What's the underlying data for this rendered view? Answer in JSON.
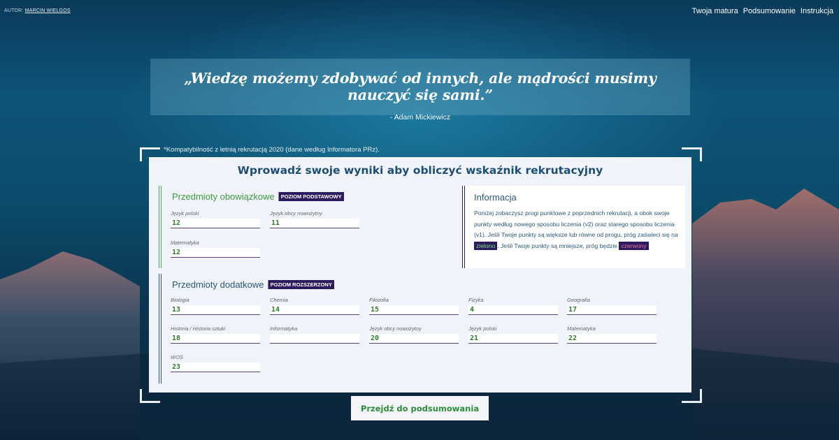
{
  "header": {
    "author_prefix": "AUTOR:",
    "author_name": "MARCIN WIELGOS",
    "nav": [
      "Twoja matura",
      "Podsumowanie",
      "Instrukcja"
    ]
  },
  "quote": {
    "text": "„Wiedzę możemy zdobywać od innych, ale mądrości musimy nauczyć się sami.”",
    "author": "- Adam Mickiewicz"
  },
  "compat_note": "*Kompatybilność z letnią rekrutacją 2020 (dane według Informatora PRz).",
  "form": {
    "title": "Wprowadź swoje wyniki aby obliczyć wskaźnik rekrutacyjny",
    "mandatory": {
      "title": "Przedmioty obowiązkowe",
      "level": "POZIOM PODSTAWOWY",
      "fields": [
        {
          "label": "Język polski",
          "value": "12"
        },
        {
          "label": "Język obcy nowożytny",
          "value": "11"
        },
        {
          "label": "Matematyka",
          "value": "12"
        }
      ]
    },
    "extra": {
      "title": "Przedmioty dodatkowe",
      "level": "POZIOM ROZSZERZONY",
      "fields": [
        {
          "label": "Biologia",
          "value": "13"
        },
        {
          "label": "Chemia",
          "value": "14"
        },
        {
          "label": "Filozofia",
          "value": "15"
        },
        {
          "label": "Fizyka",
          "value": "4"
        },
        {
          "label": "Geografia",
          "value": "17"
        },
        {
          "label": "Historia / Historia sztuki",
          "value": "18"
        },
        {
          "label": "Informatyka",
          "value": ""
        },
        {
          "label": "Język obcy nowożytny",
          "value": "20"
        },
        {
          "label": "Język polski",
          "value": "21"
        },
        {
          "label": "Matematyka",
          "value": "22"
        },
        {
          "label": "WOS",
          "value": "23"
        }
      ]
    }
  },
  "info": {
    "title": "Informacja",
    "text_1": "Poniżej zobaczysz progi punktowe z poprzednich rekrutacji, a obok swoje punkty według nowego sposobu liczenia (v2) oraz starego sposobu liczenia (v1). Jeśli Twoje punkty są większe lub równe od progu, próg zaświeci się na",
    "green_word": "zielono",
    "text_2": ". Jeśli Twoje punkty są mniejsze, próg będzie",
    "red_word": "czerwony"
  },
  "next_button": "Przejdź do podsumowania"
}
